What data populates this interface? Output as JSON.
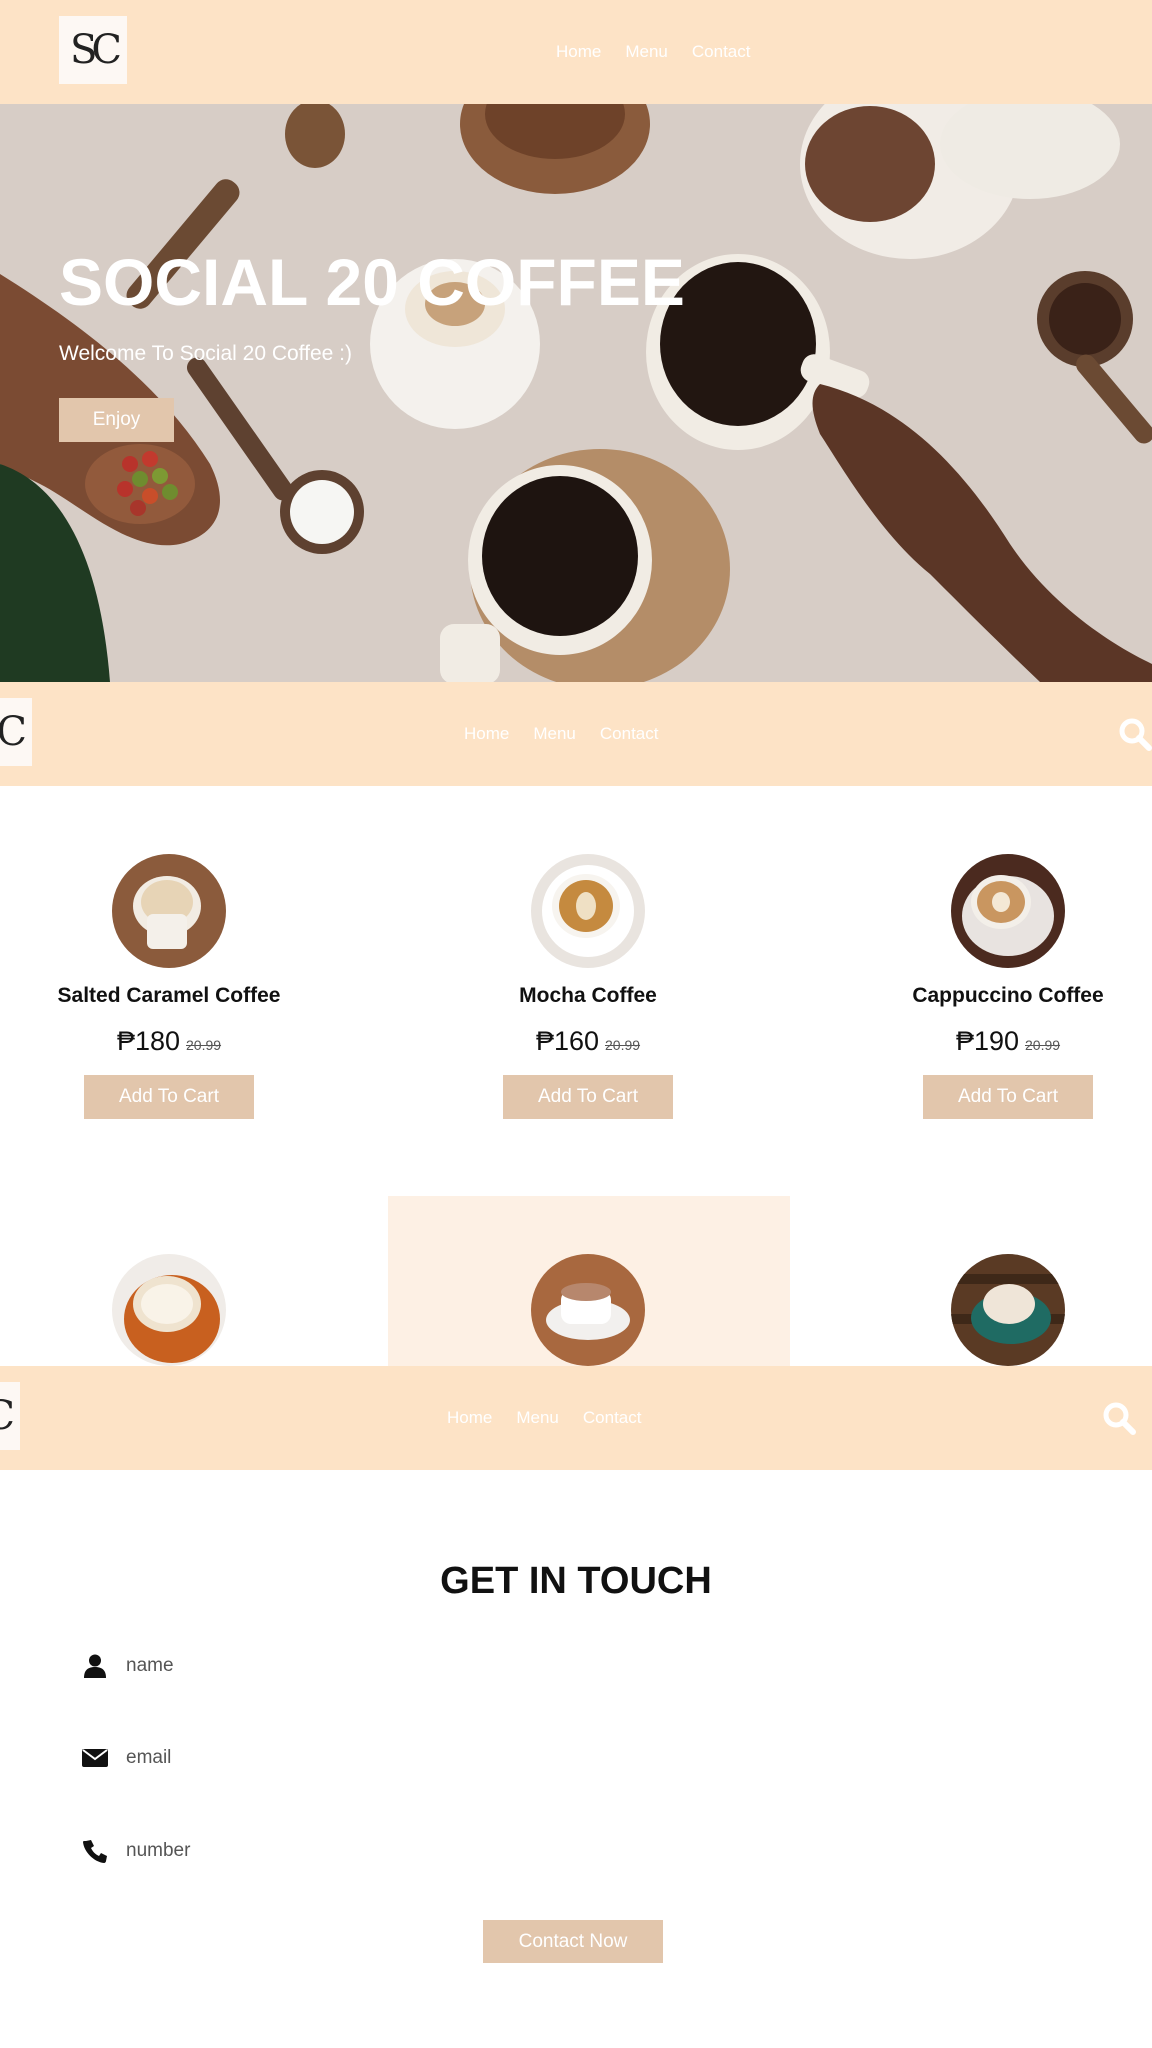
{
  "brand": {
    "logo_text": "SC"
  },
  "nav": {
    "links": [
      "Home",
      "Menu",
      "Contact"
    ]
  },
  "hero": {
    "title": "SOCIAL 20 COFFEE",
    "subtitle": "Welcome To Social 20 Coffee :)",
    "button_label": "Enjoy"
  },
  "products": [
    {
      "name": "Salted Caramel Coffee",
      "price": "₱180",
      "old_price": "20.99",
      "button_label": "Add To Cart"
    },
    {
      "name": "Mocha Coffee",
      "price": "₱160",
      "old_price": "20.99",
      "button_label": "Add To Cart"
    },
    {
      "name": "Cappuccino Coffee",
      "price": "₱190",
      "old_price": "20.99",
      "button_label": "Add To Cart"
    }
  ],
  "contact": {
    "title": "GET IN TOUCH",
    "name_placeholder": "name",
    "email_placeholder": "email",
    "number_placeholder": "number",
    "button_label": "Contact Now"
  },
  "colors": {
    "nav_bg": "#fde3c6",
    "accent_button": "#e2c6ac",
    "highlight_bg": "#fdf0e4",
    "text": "#111111"
  },
  "icons": [
    "search-icon",
    "user-icon",
    "envelope-icon",
    "phone-icon"
  ]
}
